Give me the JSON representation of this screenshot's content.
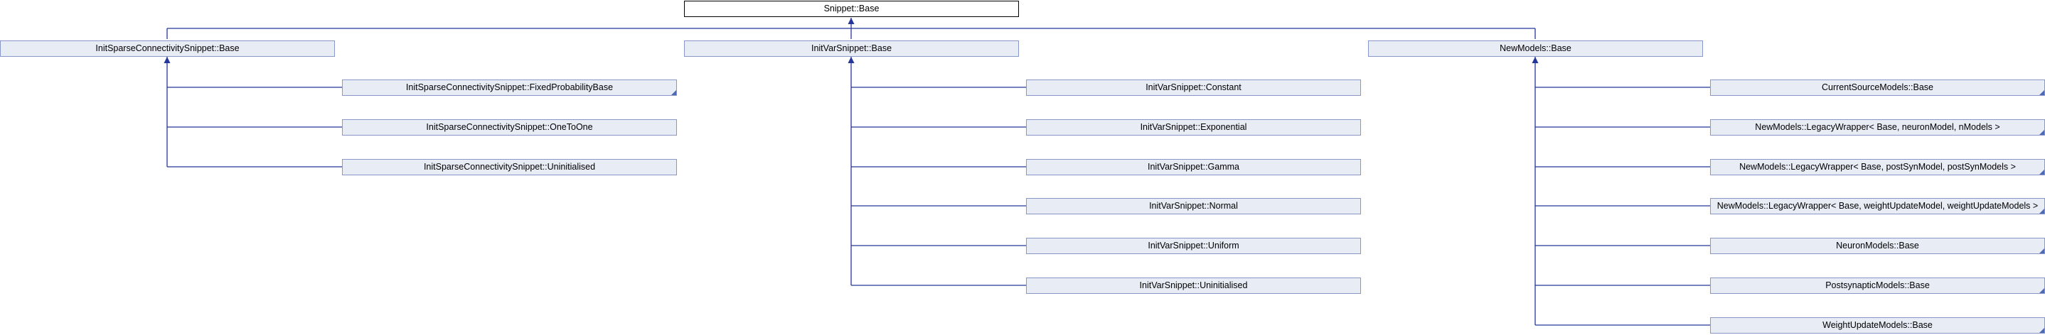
{
  "diagram": {
    "root": {
      "label": "Snippet::Base"
    },
    "level1": [
      {
        "label": "InitSparseConnectivitySnippet::Base"
      },
      {
        "label": "InitVarSnippet::Base"
      },
      {
        "label": "NewModels::Base"
      }
    ],
    "sparse_children": [
      {
        "label": "InitSparseConnectivitySnippet::FixedProbabilityBase"
      },
      {
        "label": "InitSparseConnectivitySnippet::OneToOne"
      },
      {
        "label": "InitSparseConnectivitySnippet::Uninitialised"
      }
    ],
    "initvar_children": [
      {
        "label": "InitVarSnippet::Constant"
      },
      {
        "label": "InitVarSnippet::Exponential"
      },
      {
        "label": "InitVarSnippet::Gamma"
      },
      {
        "label": "InitVarSnippet::Normal"
      },
      {
        "label": "InitVarSnippet::Uniform"
      },
      {
        "label": "InitVarSnippet::Uninitialised"
      }
    ],
    "newmodels_children": [
      {
        "label": "CurrentSourceModels::Base"
      },
      {
        "label": "NewModels::LegacyWrapper< Base, neuronModel, nModels >"
      },
      {
        "label": "NewModels::LegacyWrapper< Base, postSynModel, postSynModels >"
      },
      {
        "label": "NewModels::LegacyWrapper< Base, weightUpdateModel, weightUpdateModels >"
      },
      {
        "label": "NeuronModels::Base"
      },
      {
        "label": "PostsynapticModels::Base"
      },
      {
        "label": "WeightUpdateModels::Base"
      }
    ],
    "colors": {
      "edge": "#25369a",
      "node_fill": "#e8ecf5",
      "node_border": "#8896c8",
      "root_border": "#000000"
    }
  }
}
